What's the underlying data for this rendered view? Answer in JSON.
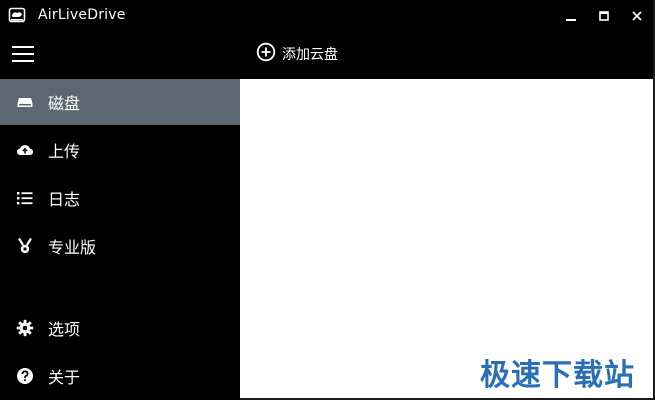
{
  "window": {
    "title": "AirLiveDrive",
    "icons": {
      "app": "cloud-drive-icon",
      "minimize": "minimize-icon",
      "maximize": "maximize-icon",
      "close": "close-icon"
    }
  },
  "toolbar": {
    "menu_icon": "hamburger-menu-icon",
    "add_cloud_icon": "add-circle-icon",
    "add_cloud_label": "添加云盘"
  },
  "sidebar": {
    "items": [
      {
        "label": "磁盘",
        "icon": "drive-icon",
        "active": true
      },
      {
        "label": "上传",
        "icon": "cloud-upload-icon",
        "active": false
      },
      {
        "label": "日志",
        "icon": "list-icon",
        "active": false
      },
      {
        "label": "专业版",
        "icon": "medal-icon",
        "active": false
      },
      {
        "label": "选项",
        "icon": "gear-icon",
        "active": false
      },
      {
        "label": "关于",
        "icon": "help-icon",
        "active": false
      }
    ]
  },
  "watermark": {
    "text": "极速下载站"
  },
  "colors": {
    "background": "#000000",
    "active_item": "#5c6771",
    "content": "#ffffff",
    "watermark": "#2a6fb5"
  }
}
